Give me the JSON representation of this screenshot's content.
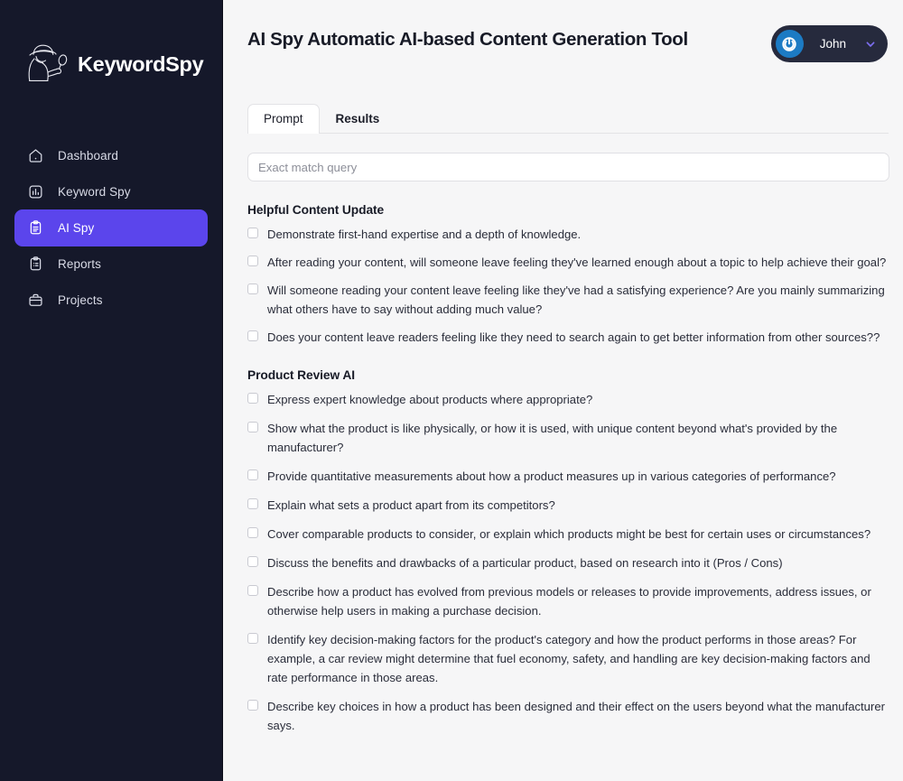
{
  "brand": {
    "name": "KeywordSpy",
    "logo_icon": "detective-spy-logo-icon"
  },
  "colors": {
    "sidebar_bg": "#15182a",
    "accent_purple": "#5b45ec",
    "avatar_blue": "#1c7bc4",
    "page_bg": "#f6f6f7",
    "chevron_purple": "#7c6ef0"
  },
  "sidebar": {
    "items": [
      {
        "label": "Dashboard",
        "icon": "home-icon",
        "active": false
      },
      {
        "label": "Keyword Spy",
        "icon": "bar-chart-icon",
        "active": false
      },
      {
        "label": "AI Spy",
        "icon": "clipboard-icon",
        "active": true
      },
      {
        "label": "Reports",
        "icon": "clipboard-list-icon",
        "active": false
      },
      {
        "label": "Projects",
        "icon": "briefcase-icon",
        "active": false
      }
    ]
  },
  "header": {
    "title": "AI Spy Automatic AI-based Content Generation Tool",
    "user": {
      "name": "John",
      "avatar_icon": "power-badge-avatar-icon",
      "chevron_icon": "chevron-down-icon"
    }
  },
  "tabs": [
    {
      "label": "Prompt",
      "active": true
    },
    {
      "label": "Results",
      "active": false
    }
  ],
  "search": {
    "placeholder": "Exact match query",
    "value": ""
  },
  "sections": [
    {
      "title": "Helpful Content Update",
      "items": [
        {
          "label": "Demonstrate first-hand expertise and a depth of knowledge.",
          "checked": false
        },
        {
          "label": "After reading your content, will someone leave feeling they've learned enough about a topic to help achieve their goal?",
          "checked": false
        },
        {
          "label": "Will someone reading your content leave feeling like they've had a satisfying experience? Are you mainly summarizing what others have to say without adding much value?",
          "checked": false
        },
        {
          "label": "Does your content leave readers feeling like they need to search again to get better information from other sources??",
          "checked": false
        }
      ]
    },
    {
      "title": "Product Review AI",
      "items": [
        {
          "label": "Express expert knowledge about products where appropriate?",
          "checked": false
        },
        {
          "label": "Show what the product is like physically, or how it is used, with unique content beyond what's provided by the manufacturer?",
          "checked": false
        },
        {
          "label": "Provide quantitative measurements about how a product measures up in various categories of performance?",
          "checked": false
        },
        {
          "label": "Explain what sets a product apart from its competitors?",
          "checked": false
        },
        {
          "label": "Cover comparable products to consider, or explain which products might be best for certain uses or circumstances?",
          "checked": false
        },
        {
          "label": "Discuss the benefits and drawbacks of a particular product, based on research into it (Pros / Cons)",
          "checked": false
        },
        {
          "label": "Describe how a product has evolved from previous models or releases to provide improvements, address issues, or otherwise help users in making a purchase decision.",
          "checked": false
        },
        {
          "label": "Identify key decision-making factors for the product's category and how the product performs in those areas? For example, a car review might determine that fuel economy, safety, and handling are key decision-making factors and rate performance in those areas.",
          "checked": false
        },
        {
          "label": "Describe key choices in how a product has been designed and their effect on the users beyond what the manufacturer says.",
          "checked": false
        }
      ]
    }
  ]
}
